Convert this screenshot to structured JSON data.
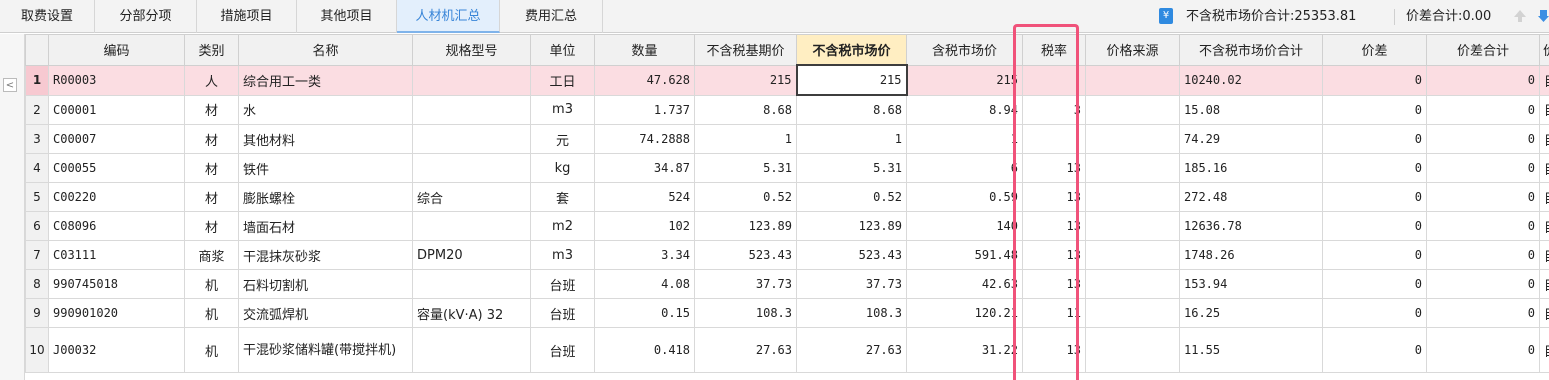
{
  "tabs": [
    "取费设置",
    "分部分项",
    "措施项目",
    "其他项目",
    "人材机汇总",
    "费用汇总"
  ],
  "active_tab": "人材机汇总",
  "summary": {
    "market_total_label": "不含税市场价合计:25353.81",
    "price_diff_label": "价差合计:0.00"
  },
  "icons": [
    "yen-icon",
    "arrow-up-icon",
    "arrow-down-icon",
    "collapse-icon"
  ],
  "colors": {
    "active_tab": "#3a86d8",
    "selected_row": "#fbdde2",
    "highlight_header": "#ffeec2",
    "annotation_box": "#f0527a"
  },
  "columns": [
    "",
    "编码",
    "类别",
    "名称",
    "规格型号",
    "单位",
    "数量",
    "不含税基期价",
    "不含税市场价",
    "含税市场价",
    "税率",
    "价格来源",
    "不含税市场价合计",
    "价差",
    "价差合计",
    "价"
  ],
  "rows": [
    {
      "n": "1",
      "code": "R00003",
      "cat": "人",
      "name": "综合用工一类",
      "spec": "",
      "unit": "工日",
      "qty": "47.628",
      "base": "215",
      "market": "215",
      "market_tax": "215",
      "rate": "",
      "source": "",
      "total": "10240.02",
      "diff": "0",
      "diff_total": "0",
      "extra": "目"
    },
    {
      "n": "2",
      "code": "C00001",
      "cat": "材",
      "name": "水",
      "spec": "",
      "unit": "m3",
      "qty": "1.737",
      "base": "8.68",
      "market": "8.68",
      "market_tax": "8.94",
      "rate": "3",
      "source": "",
      "total": "15.08",
      "diff": "0",
      "diff_total": "0",
      "extra": "目"
    },
    {
      "n": "3",
      "code": "C00007",
      "cat": "材",
      "name": "其他材料",
      "spec": "",
      "unit": "元",
      "qty": "74.2888",
      "base": "1",
      "market": "1",
      "market_tax": "1",
      "rate": "",
      "source": "",
      "total": "74.29",
      "diff": "0",
      "diff_total": "0",
      "extra": "目"
    },
    {
      "n": "4",
      "code": "C00055",
      "cat": "材",
      "name": "铁件",
      "spec": "",
      "unit": "kg",
      "qty": "34.87",
      "base": "5.31",
      "market": "5.31",
      "market_tax": "6",
      "rate": "13",
      "source": "",
      "total": "185.16",
      "diff": "0",
      "diff_total": "0",
      "extra": "目"
    },
    {
      "n": "5",
      "code": "C00220",
      "cat": "材",
      "name": "膨胀螺栓",
      "spec": "综合",
      "unit": "套",
      "qty": "524",
      "base": "0.52",
      "market": "0.52",
      "market_tax": "0.59",
      "rate": "13",
      "source": "",
      "total": "272.48",
      "diff": "0",
      "diff_total": "0",
      "extra": "目"
    },
    {
      "n": "6",
      "code": "C08096",
      "cat": "材",
      "name": "墙面石材",
      "spec": "",
      "unit": "m2",
      "qty": "102",
      "base": "123.89",
      "market": "123.89",
      "market_tax": "140",
      "rate": "13",
      "source": "",
      "total": "12636.78",
      "diff": "0",
      "diff_total": "0",
      "extra": "目"
    },
    {
      "n": "7",
      "code": "C03111",
      "cat": "商浆",
      "name": "干混抹灰砂浆",
      "spec": "DPM20",
      "unit": "m3",
      "qty": "3.34",
      "base": "523.43",
      "market": "523.43",
      "market_tax": "591.48",
      "rate": "13",
      "source": "",
      "total": "1748.26",
      "diff": "0",
      "diff_total": "0",
      "extra": "目"
    },
    {
      "n": "8",
      "code": "990745018",
      "cat": "机",
      "name": "石料切割机",
      "spec": "",
      "unit": "台班",
      "qty": "4.08",
      "base": "37.73",
      "market": "37.73",
      "market_tax": "42.63",
      "rate": "13",
      "source": "",
      "total": "153.94",
      "diff": "0",
      "diff_total": "0",
      "extra": "目"
    },
    {
      "n": "9",
      "code": "990901020",
      "cat": "机",
      "name": "交流弧焊机",
      "spec": "容量(kV·A) 32",
      "unit": "台班",
      "qty": "0.15",
      "base": "108.3",
      "market": "108.3",
      "market_tax": "120.21",
      "rate": "11",
      "source": "",
      "total": "16.25",
      "diff": "0",
      "diff_total": "0",
      "extra": "目"
    },
    {
      "n": "10",
      "code": "J00032",
      "cat": "机",
      "name": "干混砂浆储料罐(带搅拌机)",
      "spec": "",
      "unit": "台班",
      "qty": "0.418",
      "base": "27.63",
      "market": "27.63",
      "market_tax": "31.22",
      "rate": "13",
      "source": "",
      "total": "11.55",
      "diff": "0",
      "diff_total": "0",
      "extra": "目"
    }
  ]
}
